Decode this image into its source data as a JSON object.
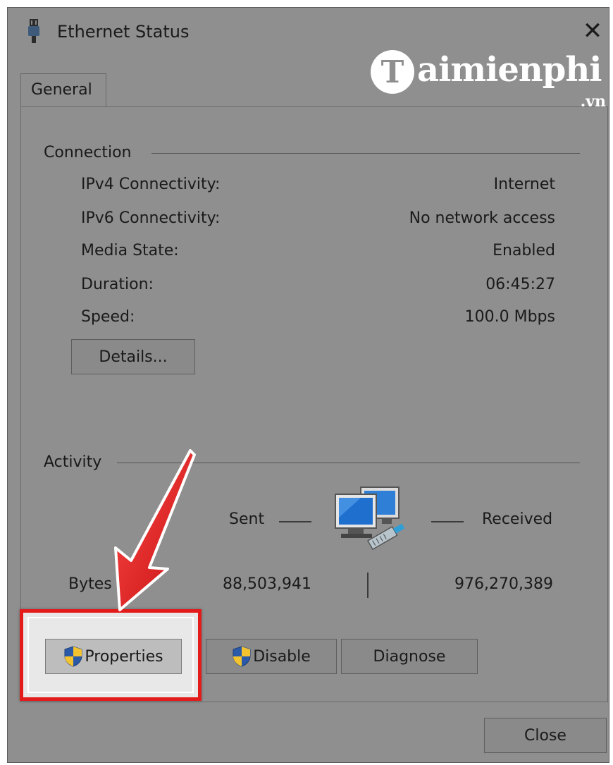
{
  "window": {
    "title": "Ethernet Status",
    "icon": "ethernet-plug-icon",
    "close_glyph": "✕"
  },
  "watermark": {
    "logo_letter": "T",
    "text": "aimienphi",
    "sub": ".vn"
  },
  "tabs": [
    {
      "label": "General"
    }
  ],
  "connection": {
    "heading": "Connection",
    "rows": [
      {
        "label": "IPv4 Connectivity:",
        "value": "Internet"
      },
      {
        "label": "IPv6 Connectivity:",
        "value": "No network access"
      },
      {
        "label": "Media State:",
        "value": "Enabled"
      },
      {
        "label": "Duration:",
        "value": "06:45:27"
      },
      {
        "label": "Speed:",
        "value": "100.0 Mbps"
      }
    ],
    "details_button": "Details..."
  },
  "activity": {
    "heading": "Activity",
    "sent_label": "Sent",
    "received_label": "Received",
    "bytes_label": "Bytes",
    "bytes_sent": "88,503,941",
    "bytes_received": "976,270,389",
    "icon": "network-computers-icon"
  },
  "buttons": {
    "properties": "Properties",
    "disable": "Disable",
    "diagnose": "Diagnose",
    "close": "Close"
  },
  "colors": {
    "annotation_red": "#e31b1b",
    "dialog_gray": "#8f8f8f"
  }
}
